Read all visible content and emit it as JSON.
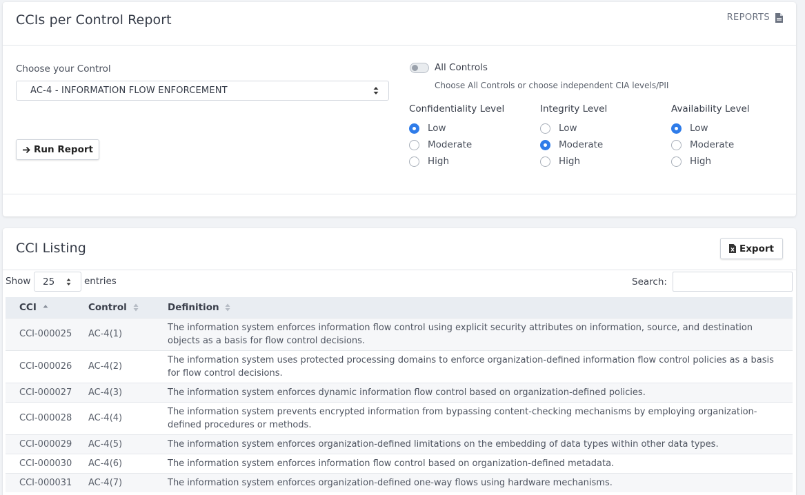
{
  "report_card": {
    "title": "CCIs per Control Report",
    "reports_link": "REPORTS",
    "control_label": "Choose your Control",
    "control_selected": "AC-4 - INFORMATION FLOW ENFORCEMENT",
    "run_button": "Run Report",
    "all_controls_label": "All Controls",
    "all_controls_on": false,
    "all_controls_help": "Choose All Controls or choose independent CIA levels/PII",
    "cia": [
      {
        "title": "Confidentiality Level",
        "options": [
          "Low",
          "Moderate",
          "High"
        ],
        "selected": "Low"
      },
      {
        "title": "Integrity Level",
        "options": [
          "Low",
          "Moderate",
          "High"
        ],
        "selected": "Moderate"
      },
      {
        "title": "Availability Level",
        "options": [
          "Low",
          "Moderate",
          "High"
        ],
        "selected": "Low"
      }
    ]
  },
  "listing_card": {
    "title": "CCI Listing",
    "export_button": "Export",
    "show_label": "Show",
    "page_length": "25",
    "entries_label": "entries",
    "search_label": "Search:",
    "search_value": "",
    "columns": [
      "CCI",
      "Control",
      "Definition"
    ],
    "rows": [
      {
        "cci": "CCI-000025",
        "control": "AC-4(1)",
        "definition": "The information system enforces information flow control using explicit security attributes on information, source, and destination objects as a basis for flow control decisions."
      },
      {
        "cci": "CCI-000026",
        "control": "AC-4(2)",
        "definition": "The information system uses protected processing domains to enforce organization-defined information flow control policies as a basis for flow control decisions."
      },
      {
        "cci": "CCI-000027",
        "control": "AC-4(3)",
        "definition": "The information system enforces dynamic information flow control based on organization-defined policies."
      },
      {
        "cci": "CCI-000028",
        "control": "AC-4(4)",
        "definition": "The information system prevents encrypted information from bypassing content-checking mechanisms by employing organization-defined procedures or methods."
      },
      {
        "cci": "CCI-000029",
        "control": "AC-4(5)",
        "definition": "The information system enforces organization-defined limitations on the embedding of data types within other data types."
      },
      {
        "cci": "CCI-000030",
        "control": "AC-4(6)",
        "definition": "The information system enforces information flow control based on organization-defined metadata."
      },
      {
        "cci": "CCI-000031",
        "control": "AC-4(7)",
        "definition": "The information system enforces organization-defined one-way flows using hardware mechanisms."
      }
    ]
  },
  "colors": {
    "accent": "#2f7ce9",
    "header_bg": "#e9edf2",
    "page_bg": "#f1f3f6"
  }
}
